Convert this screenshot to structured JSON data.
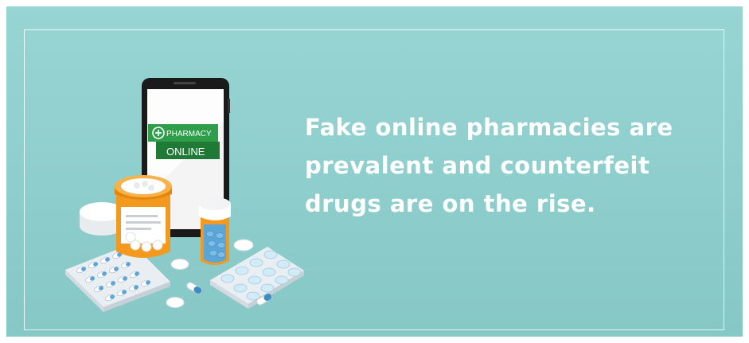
{
  "sign": {
    "top_text": "PHARMACY",
    "bottom_text": "ONLINE",
    "icon": "plus-circle-icon"
  },
  "headline": {
    "lines": [
      "Fake online pharmacies are",
      "prevalent and counterfeit",
      "drugs are on the rise."
    ]
  },
  "colors": {
    "background": "#8fd0ce",
    "frame": "#ffffff",
    "headline": "#ffffff",
    "sign_green": "#2e9e4a",
    "sign_dark_green": "#1e7a35",
    "pill_bottle": "#f39a1e",
    "blue_pill": "#5aa6d8"
  }
}
